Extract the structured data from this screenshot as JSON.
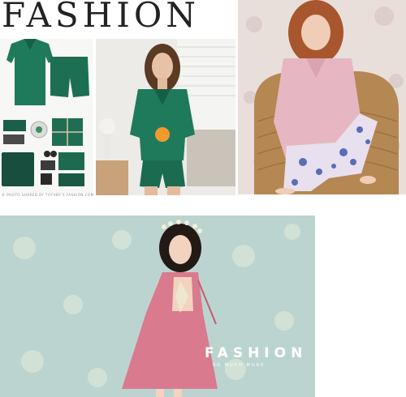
{
  "top_left": {
    "title": "FASHION"
  },
  "flatlay": {
    "watermark": "© PHOTO SHARED BY TIFFANY'S FASHION.COM"
  },
  "dress_panel": {
    "title": "FASHION",
    "subtitle": "SO MUCH MORE"
  },
  "colors": {
    "emerald": "#1f7a5c",
    "pink_pajama": "#e6b7c2",
    "floral_blue": "#5a6db5",
    "dress_pink": "#d97a8f",
    "wall_mint": "#bcd4cf"
  }
}
